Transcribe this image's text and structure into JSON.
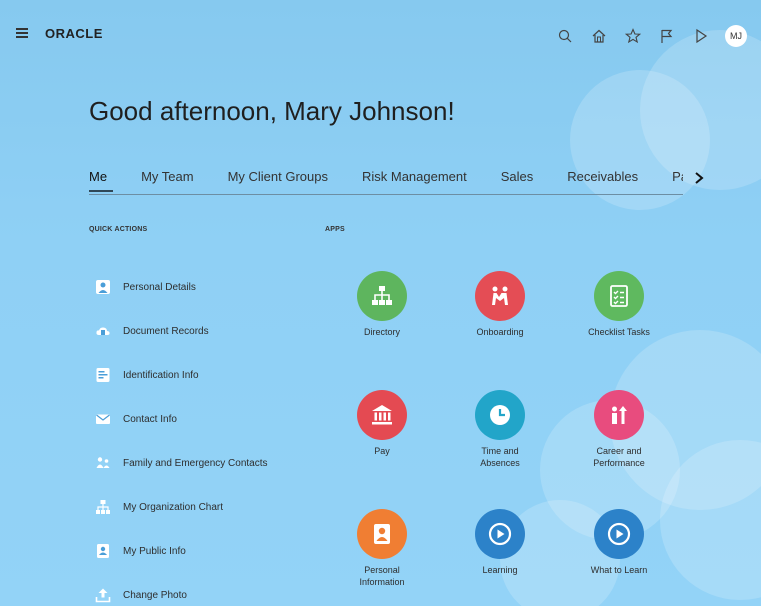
{
  "header": {
    "logo": "ORACLE",
    "icons": [
      "search-icon",
      "home-icon",
      "star-icon",
      "flag-icon",
      "play-icon"
    ],
    "avatar_initials": "MJ"
  },
  "greeting": "Good afternoon, Mary Johnson!",
  "tabs": [
    {
      "label": "Me",
      "active": true
    },
    {
      "label": "My Team"
    },
    {
      "label": "My Client Groups"
    },
    {
      "label": "Risk Management"
    },
    {
      "label": "Sales"
    },
    {
      "label": "Receivables"
    },
    {
      "label": "Pay"
    }
  ],
  "quick_actions": {
    "title": "QUICK ACTIONS",
    "items": [
      {
        "label": "Personal Details",
        "icon": "person-icon"
      },
      {
        "label": "Document Records",
        "icon": "document-cloud-icon"
      },
      {
        "label": "Identification Info",
        "icon": "id-card-icon"
      },
      {
        "label": "Contact Info",
        "icon": "envelope-icon"
      },
      {
        "label": "Family and Emergency Contacts",
        "icon": "family-icon"
      },
      {
        "label": "My Organization Chart",
        "icon": "org-chart-icon"
      },
      {
        "label": "My Public Info",
        "icon": "public-info-icon"
      },
      {
        "label": "Change Photo",
        "icon": "upload-icon"
      }
    ]
  },
  "apps": {
    "title": "APPS",
    "items": [
      {
        "label": "Directory",
        "color": "#5eb55e",
        "icon": "directory-icon"
      },
      {
        "label": "Onboarding",
        "color": "#e44d55",
        "icon": "onboarding-icon"
      },
      {
        "label": "Checklist Tasks",
        "color": "#5fb95f",
        "icon": "checklist-icon"
      },
      {
        "label": "Pay",
        "color": "#e44a52",
        "icon": "bank-icon"
      },
      {
        "label": "Time and\nAbsences",
        "color": "#22a5c9",
        "icon": "clock-icon"
      },
      {
        "label": "Career and\nPerformance",
        "color": "#e84c7e",
        "icon": "career-icon"
      },
      {
        "label": "Personal\nInformation",
        "color": "#f07e33",
        "icon": "person-badge-icon"
      },
      {
        "label": "Learning",
        "color": "#2c82c9",
        "icon": "play-circle-icon"
      },
      {
        "label": "What to Learn",
        "color": "#2c82c9",
        "icon": "play-circle-icon"
      }
    ]
  }
}
